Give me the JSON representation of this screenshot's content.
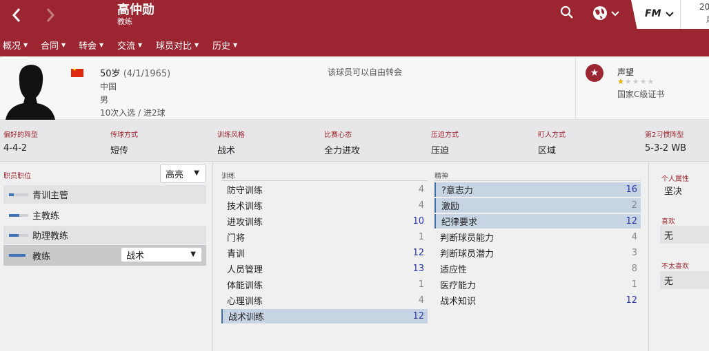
{
  "header": {
    "name": "高仲勋",
    "role": "教练",
    "brand": "FM",
    "date_line1": "20",
    "date_line2": "周"
  },
  "menu": [
    {
      "label": "概况"
    },
    {
      "label": "合同"
    },
    {
      "label": "转会"
    },
    {
      "label": "交流"
    },
    {
      "label": "球员对比"
    },
    {
      "label": "历史"
    }
  ],
  "profile": {
    "age": "50岁",
    "dob": "(4/1/1965)",
    "nationality": "中国",
    "gender": "男",
    "caps": "10次入选 / 进2球",
    "transfer_status": "该球员可以自由转会",
    "reputation_label": "声望",
    "reputation_stars": 0.5,
    "reputation_max": 5,
    "license": "国家C级证书"
  },
  "tactics": [
    {
      "label": "偏好的阵型",
      "value": "4-4-2"
    },
    {
      "label": "传球方式",
      "value": "短传"
    },
    {
      "label": "训练风格",
      "value": "战术"
    },
    {
      "label": "比赛心态",
      "value": "全力进攻"
    },
    {
      "label": "压迫方式",
      "value": "压迫"
    },
    {
      "label": "盯人方式",
      "value": "区域"
    },
    {
      "label": "第2习惯阵型",
      "value": "5-3-2 WB"
    }
  ],
  "roles": {
    "header": "职员职位",
    "view_select": "高亮",
    "items": [
      {
        "name": "青训主管",
        "level": 0.25
      },
      {
        "name": "主教练",
        "level": 0.55
      },
      {
        "name": "助理教练",
        "level": 0.5
      },
      {
        "name": "教练",
        "level": 0.85,
        "select": "战术"
      }
    ]
  },
  "training": {
    "header": "训练",
    "items": [
      {
        "name": "防守训练",
        "value": "4"
      },
      {
        "name": "技术训练",
        "value": "4"
      },
      {
        "name": "进攻训练",
        "value": "10"
      },
      {
        "name": "门将",
        "value": "1"
      },
      {
        "name": "青训",
        "value": "12"
      },
      {
        "name": "人员管理",
        "value": "13"
      },
      {
        "name": "体能训练",
        "value": "1"
      },
      {
        "name": "心理训练",
        "value": "4"
      },
      {
        "name": "战术训练",
        "value": "12"
      }
    ]
  },
  "mental": {
    "header": "精神",
    "items": [
      {
        "name": "?意志力",
        "value": "16"
      },
      {
        "name": "激励",
        "value": "2"
      },
      {
        "name": "纪律要求",
        "value": "12"
      },
      {
        "name": "判断球员能力",
        "value": "4"
      },
      {
        "name": "判断球员潜力",
        "value": "3"
      },
      {
        "name": "适应性",
        "value": "8"
      },
      {
        "name": "医疗能力",
        "value": "1"
      },
      {
        "name": "战术知识",
        "value": "12"
      }
    ]
  },
  "personal": {
    "attr_label": "个人属性",
    "attr_value": "坚决",
    "likes_label": "喜欢",
    "likes_value": "无",
    "dislikes_label": "不太喜欢",
    "dislikes_value": "无"
  },
  "colors": {
    "brand": "#9b2530",
    "highlight": "#c6d4e4",
    "good_value": "#2a36a8"
  }
}
